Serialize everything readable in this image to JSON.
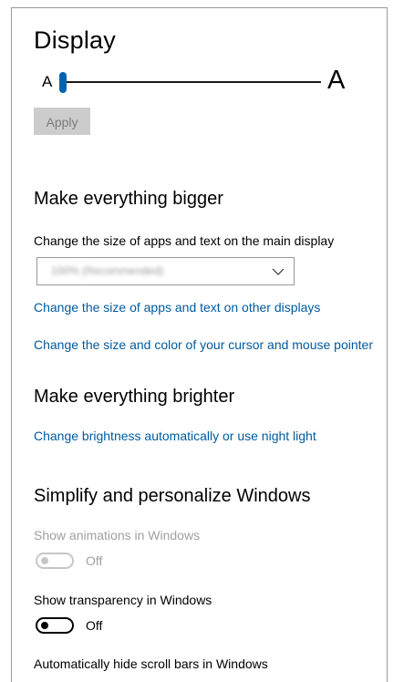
{
  "page": {
    "title": "Display"
  },
  "text_size": {
    "small_label": "A",
    "large_label": "A",
    "level": 0.0,
    "apply_label": "Apply"
  },
  "bigger": {
    "heading": "Make everything bigger",
    "description": "Change the size of apps and text on the main display",
    "scale_value": "100% (Recommended)",
    "link_other_displays": "Change the size of apps and text on other displays",
    "link_cursor": "Change the size and color of your cursor and mouse pointer"
  },
  "brighter": {
    "heading": "Make everything brighter",
    "link_brightness": "Change brightness automatically or use night light"
  },
  "simplify": {
    "heading": "Simplify and personalize Windows",
    "animations_label": "Show animations in Windows",
    "animations_state": "Off",
    "transparency_label": "Show transparency in Windows",
    "transparency_state": "Off",
    "scrollbars_label": "Automatically hide scroll bars in Windows"
  },
  "colors": {
    "accent": "#0063b1",
    "link": "#005a9e",
    "disabled": "#a0a0a0"
  }
}
